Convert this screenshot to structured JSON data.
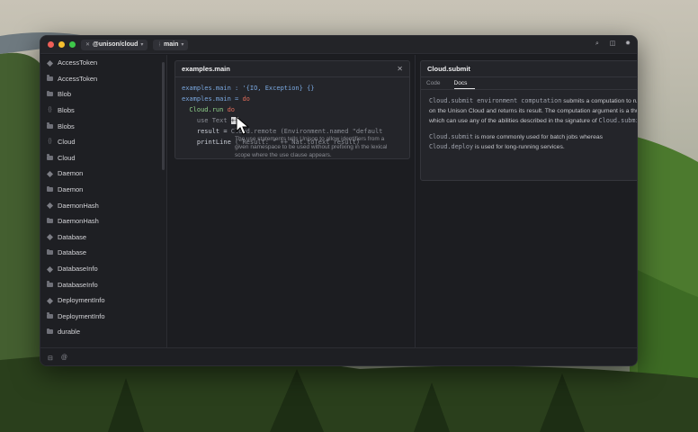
{
  "titlebar": {
    "project": "@unison/cloud",
    "branch": "main"
  },
  "sidebar": {
    "items": [
      {
        "label": "AccessToken",
        "icon": "diamond"
      },
      {
        "label": "AccessToken",
        "icon": "folder"
      },
      {
        "label": "Blob",
        "icon": "folder"
      },
      {
        "label": "Blobs",
        "icon": "braces"
      },
      {
        "label": "Blobs",
        "icon": "folder"
      },
      {
        "label": "Cloud",
        "icon": "braces"
      },
      {
        "label": "Cloud",
        "icon": "folder"
      },
      {
        "label": "Daemon",
        "icon": "diamond"
      },
      {
        "label": "Daemon",
        "icon": "folder"
      },
      {
        "label": "DaemonHash",
        "icon": "diamond"
      },
      {
        "label": "DaemonHash",
        "icon": "folder"
      },
      {
        "label": "Database",
        "icon": "diamond"
      },
      {
        "label": "Database",
        "icon": "folder"
      },
      {
        "label": "DatabaseInfo",
        "icon": "diamond"
      },
      {
        "label": "DatabaseInfo",
        "icon": "folder"
      },
      {
        "label": "DeploymentInfo",
        "icon": "diamond"
      },
      {
        "label": "DeploymentInfo",
        "icon": "folder"
      },
      {
        "label": "durable",
        "icon": "folder"
      }
    ]
  },
  "left_panel": {
    "title": "examples.main",
    "code": {
      "l1a": "examples.main : '{IO, Exception} {}",
      "l2a": "examples.main = ",
      "l2b": "do",
      "l3a": "  Cloud.run ",
      "l3b": "do",
      "l4a": "    use Text ",
      "l4b": "++",
      "l5a": "    result = ",
      "l5b": "Cloud.remote (Environment.named \"default",
      "l6a": "    printLine ",
      "l6b": "(\"Result: \" ++ Nat.toText result)"
    },
    "tooltip": "The use statements tells Unison to allow identifiers from a given namespace to be used without prefixing in the lexical scope where the use clause appears."
  },
  "right_panel": {
    "title": "Cloud.submit",
    "tabs": [
      {
        "label": "Code",
        "active": false
      },
      {
        "label": "Docs",
        "active": true
      }
    ],
    "docs": {
      "p1_code": "Cloud.submit environment computation",
      "p1_text": " submits a computation to run on the Unison Cloud and returns its result. The computation argument is a thunk which can use any of the abilities described in the signature of ",
      "p1_code2": "Cloud.submit",
      "p1_end": ".",
      "p2_code": "Cloud.submit",
      "p2_text": " is more commonly used for batch jobs whereas ",
      "p2_code2": "Cloud.deploy",
      "p2_end": " is used for long-running services."
    }
  },
  "colors": {
    "accent_keyword": "#e06c5a",
    "window_bg": "#1a1b1f"
  }
}
